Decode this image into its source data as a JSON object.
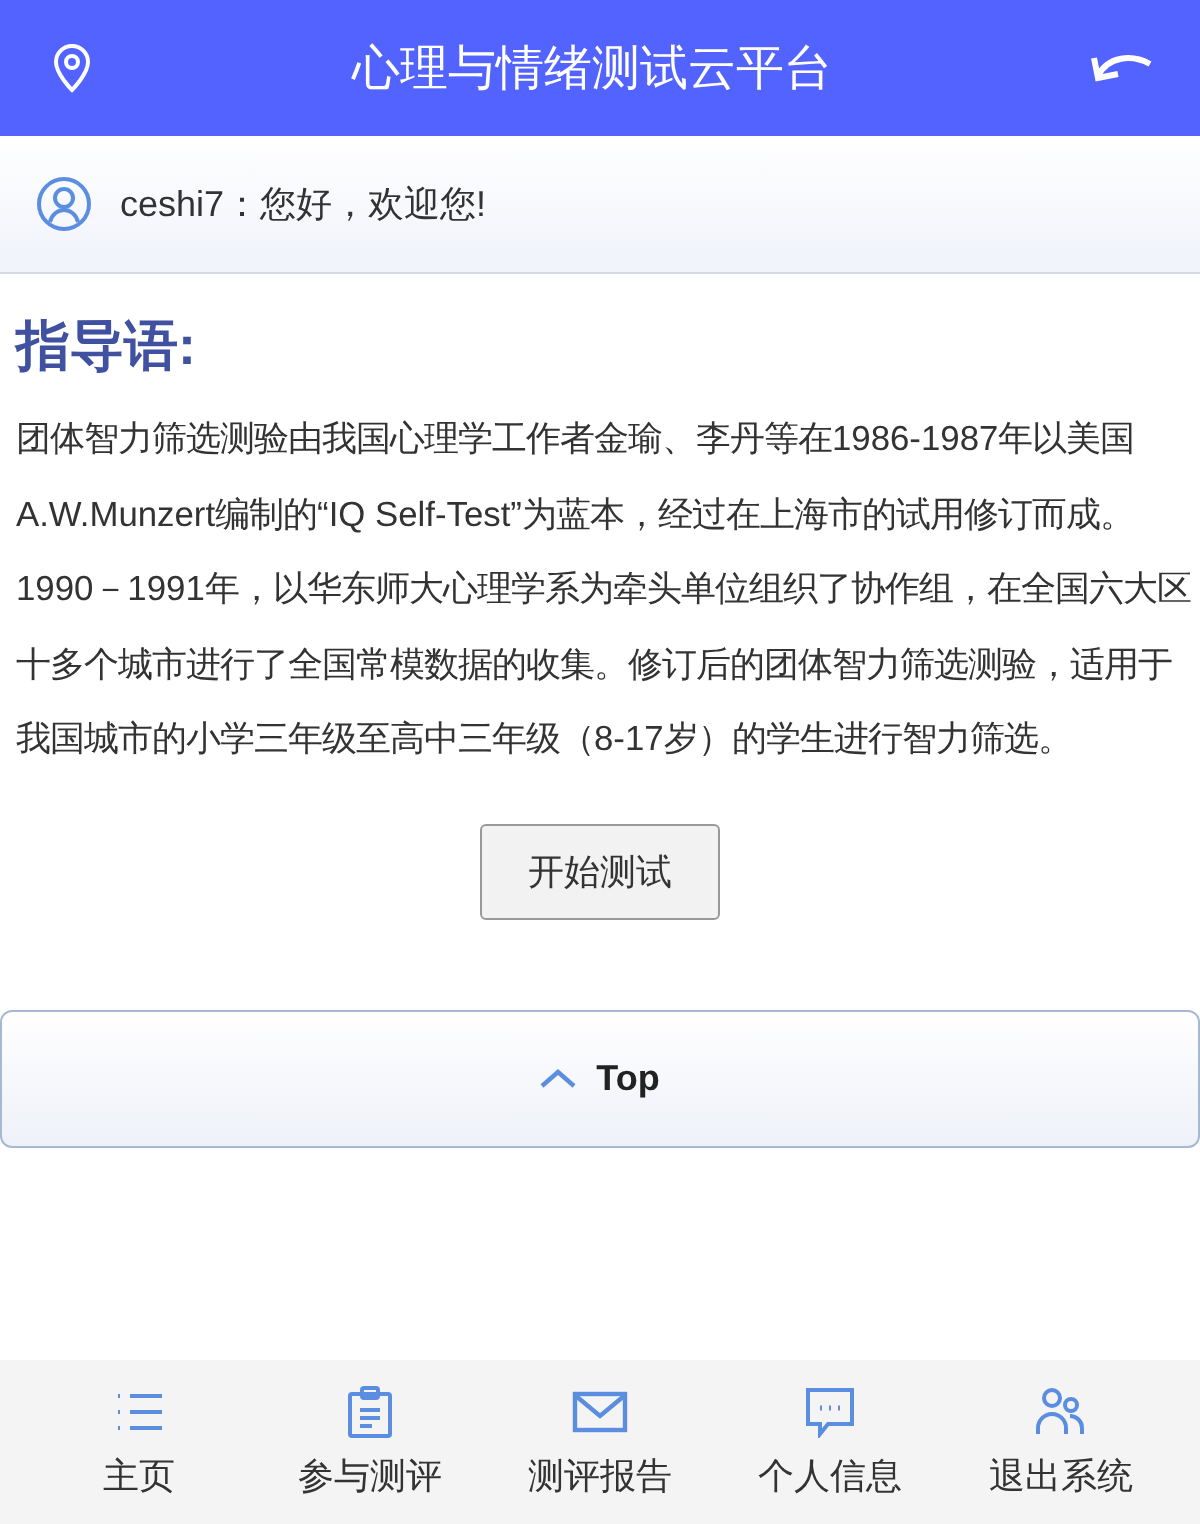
{
  "header": {
    "title": "心理与情绪测试云平台"
  },
  "welcome": {
    "text": "ceshi7：您好，欢迎您!"
  },
  "instructions": {
    "heading": "指导语:",
    "body": "团体智力筛选测验由我国心理学工作者金瑜、李丹等在1986-1987年以美国A.W.Munzert编制的“IQ Self-Test”为蓝本，经过在上海市的试用修订而成。1990－1991年，以华东师大心理学系为牵头单位组织了协作组，在全国六大区十多个城市进行了全国常模数据的收集。修订后的团体智力筛选测验，适用于我国城市的小学三年级至高中三年级（8-17岁）的学生进行智力筛选。"
  },
  "start_button": "开始测试",
  "top_button": "Top",
  "bottom_nav": [
    {
      "kind": "list",
      "label": "主页"
    },
    {
      "kind": "clipboard",
      "label": "参与测评"
    },
    {
      "kind": "mail",
      "label": "测评报告"
    },
    {
      "kind": "chat",
      "label": "个人信息"
    },
    {
      "kind": "users",
      "label": "退出系统"
    }
  ]
}
